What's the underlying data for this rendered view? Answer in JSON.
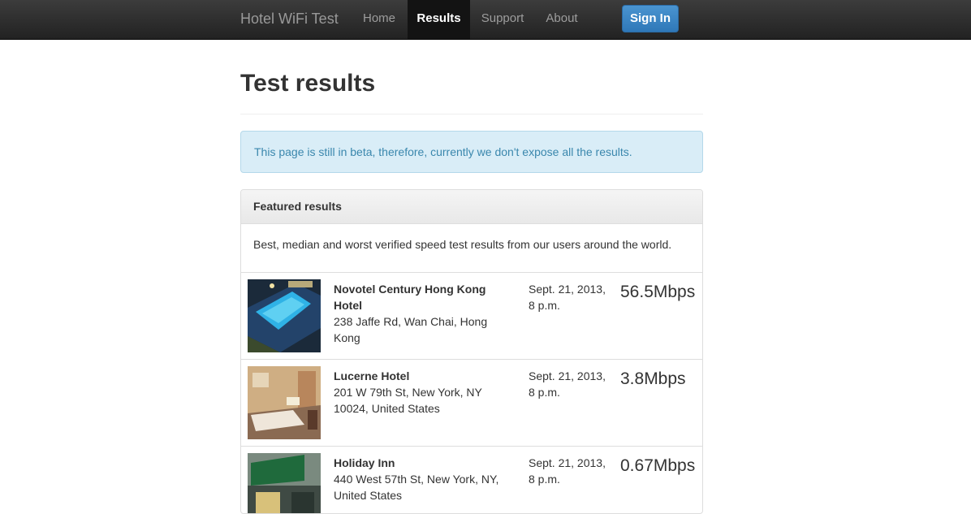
{
  "navbar": {
    "brand": "Hotel WiFi Test",
    "items": [
      {
        "label": "Home",
        "active": false
      },
      {
        "label": "Results",
        "active": true
      },
      {
        "label": "Support",
        "active": false
      },
      {
        "label": "About",
        "active": false
      }
    ],
    "sign_in_label": "Sign In"
  },
  "page": {
    "title": "Test results",
    "alert": "This page is still in beta, therefore, currently we don't expose all the results."
  },
  "panel": {
    "heading": "Featured results",
    "body": "Best, median and worst verified speed test results from our users around the world.",
    "results": [
      {
        "name": "Novotel Century Hong Kong Hotel",
        "address": "238 Jaffe Rd, Wan Chai, Hong Kong",
        "date": "Sept. 21, 2013, 8 p.m.",
        "speed": "56.5Mbps"
      },
      {
        "name": "Lucerne Hotel",
        "address": "201 W 79th St, New York, NY 10024, United States",
        "date": "Sept. 21, 2013, 8 p.m.",
        "speed": "3.8Mbps"
      },
      {
        "name": "Holiday Inn",
        "address": "440 West 57th St, New York, NY, United States",
        "date": "Sept. 21, 2013, 8 p.m.",
        "speed": "0.67Mbps"
      }
    ]
  },
  "colors": {
    "navbar_bg": "#222222",
    "link_active": "#ffffff",
    "primary_button": "#3a84c4",
    "alert_bg": "#d9edf7",
    "alert_text": "#3a87ad"
  }
}
